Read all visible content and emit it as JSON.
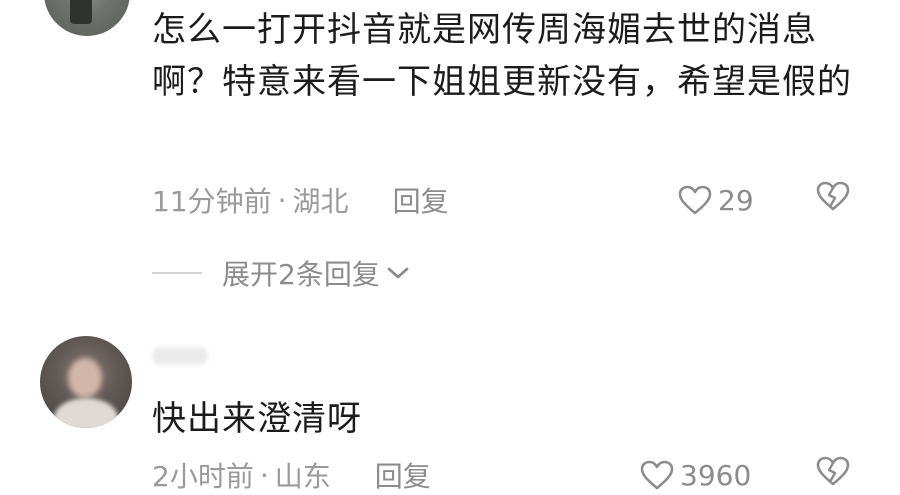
{
  "comments": [
    {
      "text": "怎么一打开抖音就是网传周海媚去世的消息啊？特意来看一下姐姐更新没有，希望是假的",
      "time": "11分钟前",
      "separator": "·",
      "location": "湖北",
      "reply_label": "回复",
      "like_count": "29",
      "expand_replies_label": "展开2条回复"
    },
    {
      "text": "快出来澄清呀",
      "time": "2小时前",
      "separator": "·",
      "location": "山东",
      "reply_label": "回复",
      "like_count": "3960"
    }
  ],
  "icons": {
    "like": "heart-outline-icon",
    "dislike": "broken-heart-icon",
    "expand": "chevron-down-icon"
  },
  "colors": {
    "text_primary": "#1c1c1c",
    "text_meta": "#9a9a9a",
    "icon": "#8c8c8c"
  }
}
